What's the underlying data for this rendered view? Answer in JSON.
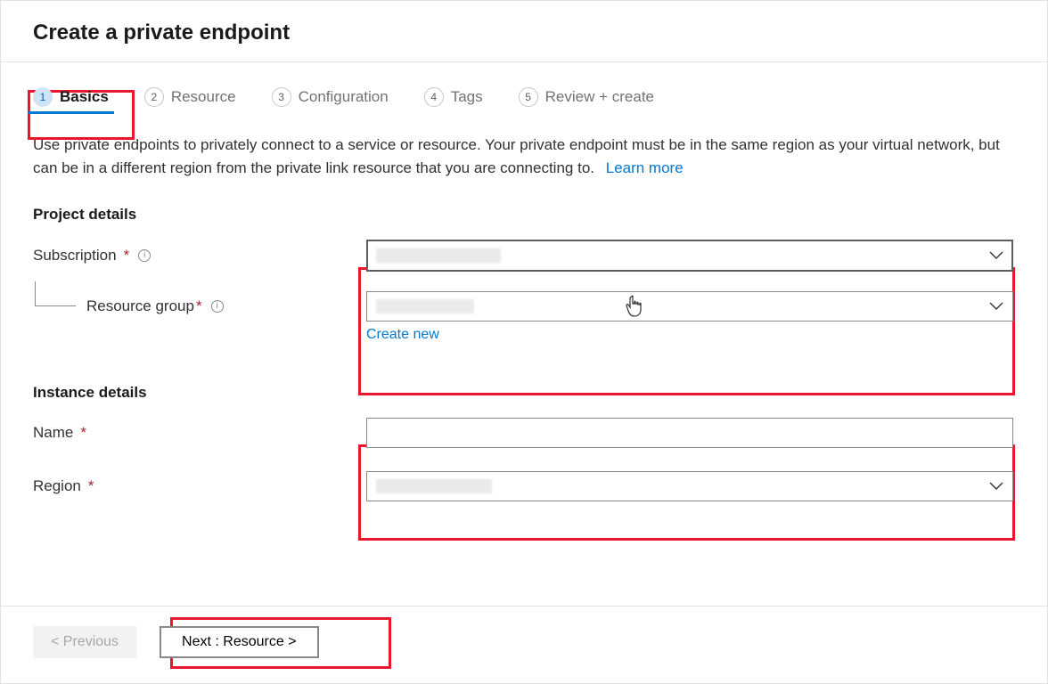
{
  "header": {
    "title": "Create a private endpoint"
  },
  "tabs": [
    {
      "num": "1",
      "label": "Basics"
    },
    {
      "num": "2",
      "label": "Resource"
    },
    {
      "num": "3",
      "label": "Configuration"
    },
    {
      "num": "4",
      "label": "Tags"
    },
    {
      "num": "5",
      "label": "Review + create"
    }
  ],
  "intro": {
    "text": "Use private endpoints to privately connect to a service or resource. Your private endpoint must be in the same region as your virtual network, but can be in a different region from the private link resource that you are connecting to.",
    "link": "Learn more"
  },
  "sections": {
    "project": {
      "title": "Project details",
      "subscription_label": "Subscription",
      "resource_group_label": "Resource group",
      "create_new": "Create new"
    },
    "instance": {
      "title": "Instance details",
      "name_label": "Name",
      "region_label": "Region"
    }
  },
  "fields": {
    "subscription_value": "",
    "resource_group_value": "",
    "name_value": "",
    "region_value": ""
  },
  "footer": {
    "previous": "< Previous",
    "next": "Next : Resource >"
  },
  "icons": {
    "info_glyph": "i"
  }
}
